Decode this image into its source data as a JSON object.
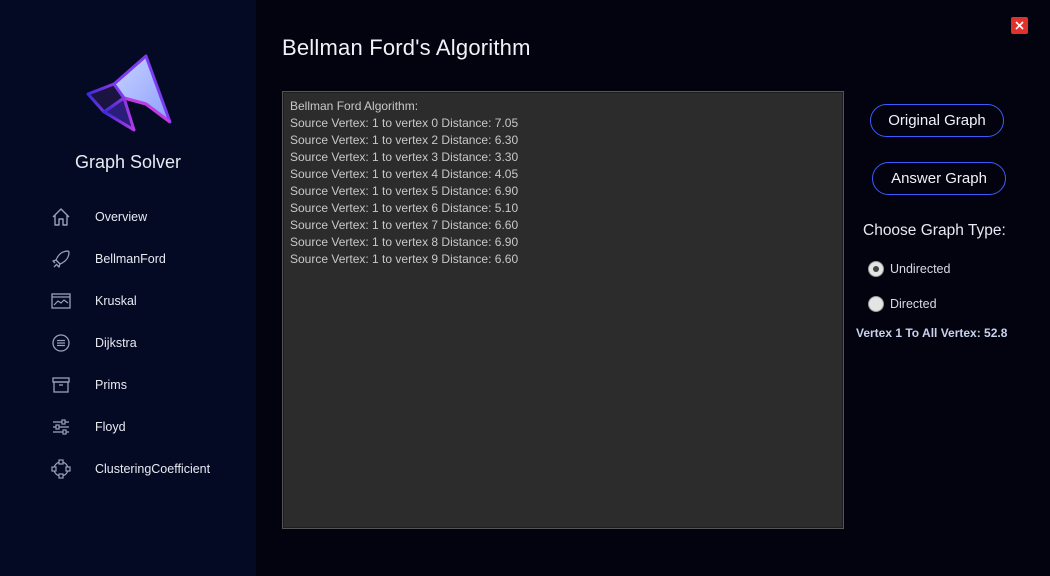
{
  "window": {
    "title": "Bellman Ford's Algorithm"
  },
  "sidebar": {
    "app_name": "Graph Solver",
    "items": [
      {
        "label": "Overview",
        "icon": "home-icon"
      },
      {
        "label": "BellmanFord",
        "icon": "rocket-icon"
      },
      {
        "label": "Kruskal",
        "icon": "chart-window-icon"
      },
      {
        "label": "Dijkstra",
        "icon": "list-circle-icon"
      },
      {
        "label": "Prims",
        "icon": "archive-box-icon"
      },
      {
        "label": "Floyd",
        "icon": "sliders-icon"
      },
      {
        "label": "ClusteringCoefficient",
        "icon": "nodes-ring-icon"
      }
    ]
  },
  "output": {
    "lines": [
      "Bellman Ford Algorithm:",
      "Source Vertex: 1 to vertex 0 Distance: 7.05",
      "Source Vertex: 1 to vertex 2 Distance: 6.30",
      "Source Vertex: 1 to vertex 3 Distance: 3.30",
      "Source Vertex: 1 to vertex 4 Distance: 4.05",
      "Source Vertex: 1 to vertex 5 Distance: 6.90",
      "Source Vertex: 1 to vertex 6 Distance: 5.10",
      "Source Vertex: 1 to vertex 7 Distance: 6.60",
      "Source Vertex: 1 to vertex 8 Distance: 6.90",
      "Source Vertex: 1 to vertex 9 Distance: 6.60"
    ]
  },
  "actions": {
    "original_graph_label": "Original Graph",
    "answer_graph_label": "Answer Graph"
  },
  "graph_type": {
    "label": "Choose Graph Type:",
    "options": [
      "Undirected",
      "Directed"
    ],
    "selected": "Undirected"
  },
  "summary": "Vertex 1 To All Vertex: 52.8",
  "colors": {
    "sidebar_bg": "#050a24",
    "main_bg": "#02030e",
    "accent": "#3c5bff",
    "close": "#e0322c",
    "output_bg": "#2c2c2c"
  }
}
